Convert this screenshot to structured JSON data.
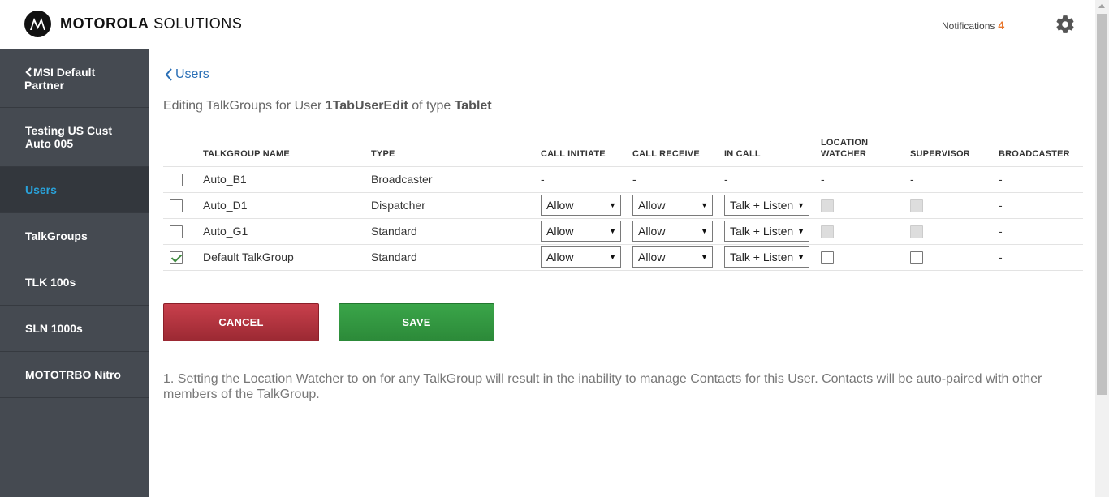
{
  "header": {
    "brand_bold": "MOTOROLA",
    "brand_light": "SOLUTIONS",
    "notifications_label": "Notifications",
    "notifications_count": "4"
  },
  "sidebar": {
    "back_label": "MSI Default Partner",
    "items": [
      {
        "label": "Testing US Cust Auto 005",
        "active": false
      },
      {
        "label": "Users",
        "active": true
      },
      {
        "label": "TalkGroups",
        "active": false
      },
      {
        "label": "TLK 100s",
        "active": false
      },
      {
        "label": "SLN 1000s",
        "active": false
      },
      {
        "label": "MOTOTRBO Nitro",
        "active": false
      }
    ]
  },
  "main": {
    "back_link": "Users",
    "heading_prefix": "Editing TalkGroups for User",
    "user_name": "1TabUserEdit",
    "heading_mid": "of type",
    "user_type": "Tablet",
    "columns": [
      "TALKGROUP NAME",
      "TYPE",
      "CALL INITIATE",
      "CALL RECEIVE",
      "IN CALL",
      "LOCATION WATCHER",
      "SUPERVISOR",
      "BROADCASTER"
    ],
    "rows": [
      {
        "checked": false,
        "name": "Auto_B1",
        "type": "Broadcaster",
        "call_initiate": "-",
        "call_receive": "-",
        "in_call": "-",
        "location_watcher": "-",
        "supervisor": "-",
        "broadcaster": "-"
      },
      {
        "checked": false,
        "name": "Auto_D1",
        "type": "Dispatcher",
        "call_initiate": "Allow",
        "call_receive": "Allow",
        "in_call": "Talk + Listen",
        "location_watcher": "disabled",
        "supervisor": "disabled",
        "broadcaster": "-"
      },
      {
        "checked": false,
        "name": "Auto_G1",
        "type": "Standard",
        "call_initiate": "Allow",
        "call_receive": "Allow",
        "in_call": "Talk + Listen",
        "location_watcher": "disabled",
        "supervisor": "disabled",
        "broadcaster": "-"
      },
      {
        "checked": true,
        "name": "Default TalkGroup",
        "type": "Standard",
        "call_initiate": "Allow",
        "call_receive": "Allow",
        "in_call": "Talk + Listen",
        "location_watcher": "unchecked",
        "supervisor": "unchecked",
        "broadcaster": "-"
      }
    ],
    "cancel_label": "CANCEL",
    "save_label": "SAVE",
    "note": "1. Setting the Location Watcher to on for any TalkGroup will result in the inability to manage Contacts for this User. Contacts will be auto-paired with other members of the TalkGroup."
  },
  "colors": {
    "accent_blue": "#29a3dc",
    "notification_orange": "#e8762d",
    "cancel_red": "#b3343f",
    "save_green": "#34994a",
    "sidebar_bg": "#454a51"
  }
}
